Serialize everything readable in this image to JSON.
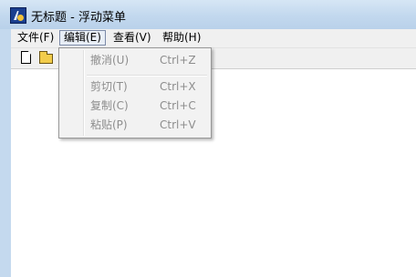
{
  "window": {
    "title": "无标题 - 浮动菜单"
  },
  "menubar": {
    "items": [
      {
        "label": "文件(F)"
      },
      {
        "label": "编辑(E)",
        "active": true
      },
      {
        "label": "查看(V)"
      },
      {
        "label": "帮助(H)"
      }
    ]
  },
  "toolbar": {
    "buttons": [
      {
        "icon": "new-document-icon"
      },
      {
        "icon": "open-folder-icon"
      }
    ]
  },
  "edit_menu": {
    "items": [
      {
        "label": "撤消(U)",
        "shortcut": "Ctrl+Z",
        "enabled": false
      },
      {
        "label": "剪切(T)",
        "shortcut": "Ctrl+X",
        "enabled": false
      },
      {
        "label": "复制(C)",
        "shortcut": "Ctrl+C",
        "enabled": false
      },
      {
        "label": "粘贴(P)",
        "shortcut": "Ctrl+V",
        "enabled": false
      }
    ]
  },
  "colors": {
    "titlebar": "#c2d8ee",
    "menubar": "#f0f0f0",
    "disabled_text": "#8d8d8d",
    "active_menu_border": "#7b8aa8"
  }
}
